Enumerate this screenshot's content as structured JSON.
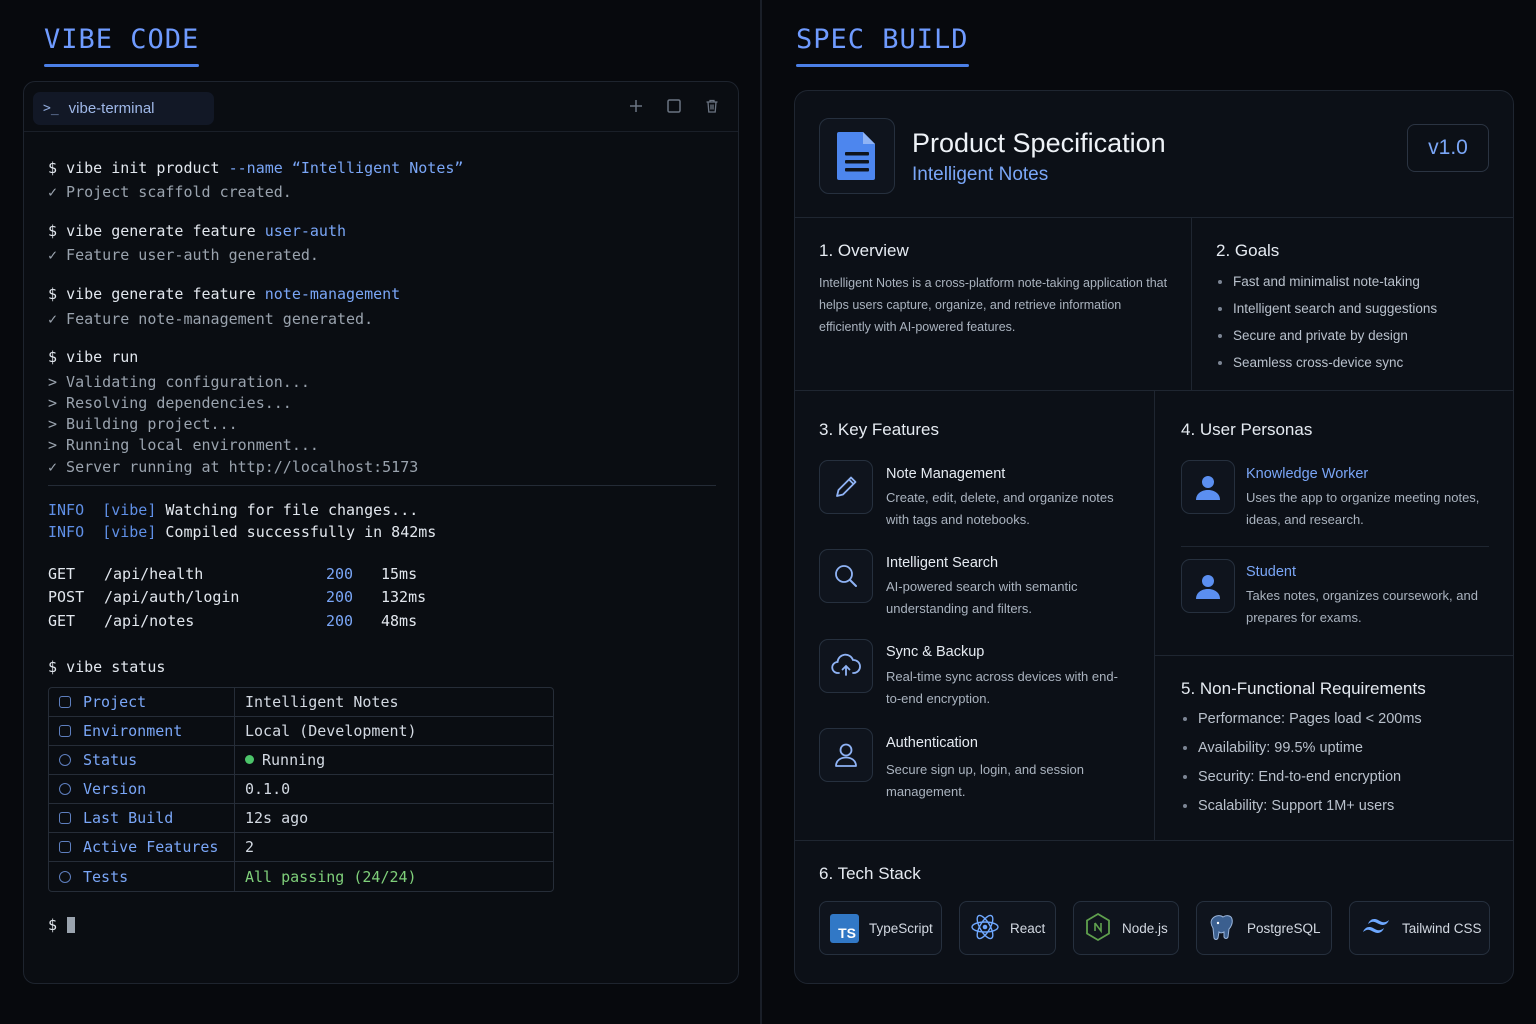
{
  "left": {
    "title": "VIBE CODE",
    "tab_label": "vibe-terminal",
    "lines": [
      {
        "prompt": "$ ",
        "cmd": "vibe init product ",
        "arg": "--name “Intelligent Notes”"
      },
      {
        "text": "✓ Project scaffold created."
      },
      {
        "prompt": "$ ",
        "cmd": "vibe generate feature ",
        "arg": "user-auth"
      },
      {
        "text": "✓ Feature user-auth generated."
      },
      {
        "prompt": "$ ",
        "cmd": "vibe generate feature ",
        "arg": "note-management"
      },
      {
        "text": "✓ Feature note-management generated."
      },
      {
        "prompt": "$ ",
        "cmd": "vibe run"
      },
      {
        "text": "> Validating configuration..."
      },
      {
        "text": "> Resolving dependencies..."
      },
      {
        "text": "> Building project..."
      },
      {
        "text": "> Running local environment..."
      },
      {
        "text": "✓ Server running at http://localhost:5173"
      }
    ],
    "info_lines": [
      {
        "level": "INFO",
        "tag": "[vibe]",
        "msg": "Watching for file changes..."
      },
      {
        "level": "INFO",
        "tag": "[vibe]",
        "msg": "Compiled successfully in 842ms"
      }
    ],
    "requests": [
      {
        "method": "GET",
        "path": "/api/health",
        "code": "200",
        "time": "15ms"
      },
      {
        "method": "POST",
        "path": "/api/auth/login",
        "code": "200",
        "time": "132ms"
      },
      {
        "method": "GET",
        "path": "/api/notes",
        "code": "200",
        "time": "48ms"
      }
    ],
    "status_cmd": {
      "prompt": "$ ",
      "cmd": "vibe status"
    },
    "status_rows": [
      {
        "key": "Project",
        "value": "Intelligent Notes"
      },
      {
        "key": "Environment",
        "value": "Local (Development)"
      },
      {
        "key": "Status",
        "value": "Running"
      },
      {
        "key": "Version",
        "value": "0.1.0"
      },
      {
        "key": "Last Build",
        "value": "12s ago"
      },
      {
        "key": "Active Features",
        "value": "2"
      },
      {
        "key": "Tests",
        "value": "All passing (24/24)"
      }
    ],
    "final_prompt": "$"
  },
  "right": {
    "title": "SPEC BUILD",
    "spec_title": "Product Specification",
    "spec_subtitle": "Intelligent Notes",
    "version": "v1.0",
    "overview": {
      "heading": "1. Overview",
      "text": "Intelligent Notes is a cross-platform note-taking application that helps users capture, organize, and retrieve information efficiently with AI-powered features."
    },
    "goals": {
      "heading": "2. Goals",
      "items": [
        "Fast and minimalist note-taking",
        "Intelligent search and suggestions",
        "Secure and private by design",
        "Seamless cross-device sync"
      ]
    },
    "features": {
      "heading": "3. Key Features",
      "items": [
        {
          "icon": "pencil-icon",
          "title": "Note Management",
          "desc": "Create, edit, delete, and organize notes with tags and notebooks."
        },
        {
          "icon": "search-icon",
          "title": "Intelligent Search",
          "desc": "AI-powered search with semantic understanding and filters."
        },
        {
          "icon": "cloud-sync-icon",
          "title": "Sync & Backup",
          "desc": "Real-time sync across devices with end-to-end encryption."
        },
        {
          "icon": "user-icon",
          "title": "Authentication",
          "desc": "Secure sign up, login, and session management."
        }
      ]
    },
    "personas": {
      "heading": "4. User Personas",
      "items": [
        {
          "title": "Knowledge Worker",
          "desc": "Uses the app to organize meeting notes, ideas, and research."
        },
        {
          "title": "Student",
          "desc": "Takes notes, organizes coursework, and prepares for exams."
        }
      ]
    },
    "nfr": {
      "heading": "5. Non-Functional Requirements",
      "items": [
        "Performance: Pages load < 200ms",
        "Availability: 99.5% uptime",
        "Security: End-to-end encryption",
        "Scalability: Support 1M+ users"
      ]
    },
    "tech": {
      "heading": "6. Tech Stack",
      "items": [
        {
          "icon": "typescript-icon",
          "label": "TypeScript",
          "badge": "TS"
        },
        {
          "icon": "react-icon",
          "label": "React"
        },
        {
          "icon": "nodejs-icon",
          "label": "Node.js"
        },
        {
          "icon": "postgresql-icon",
          "label": "PostgreSQL"
        },
        {
          "icon": "tailwind-icon",
          "label": "Tailwind CSS"
        }
      ]
    },
    "colors": {
      "accent": "#7aa6f7",
      "success": "#4cc46a",
      "background": "#07090d"
    }
  }
}
